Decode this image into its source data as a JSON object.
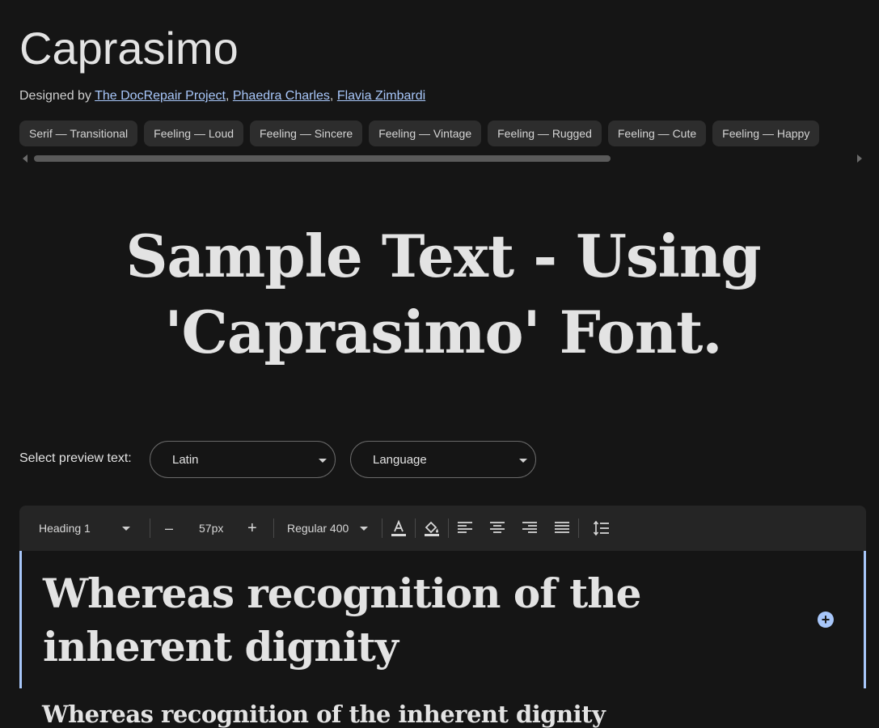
{
  "font": {
    "name": "Caprasimo",
    "designed_by_label": "Designed by",
    "designers": [
      "The DocRepair Project",
      "Phaedra Charles",
      "Flavia Zimbardi"
    ]
  },
  "tags": [
    "Serif — Transitional",
    "Feeling — Loud",
    "Feeling — Sincere",
    "Feeling — Vintage",
    "Feeling — Rugged",
    "Feeling — Cute",
    "Feeling — Happy"
  ],
  "sample": {
    "line1": "Sample Text - Using",
    "line2": "'Caprasimo' Font."
  },
  "preview": {
    "label": "Select preview text:",
    "script_value": "Latin",
    "language_value": "Language"
  },
  "toolbar": {
    "style": "Heading 1",
    "decrease": "–",
    "size": "57px",
    "increase": "+",
    "weight": "Regular 400"
  },
  "editor": {
    "heading_text": "Whereas recognition of the inherent dignity",
    "add_symbol": "+",
    "next_text": "Whereas recognition of the inherent dignity"
  },
  "colors": {
    "background": "#151515",
    "accent": "#a8c7fa",
    "chip": "#2d2d2d",
    "toolbar": "#252525"
  }
}
